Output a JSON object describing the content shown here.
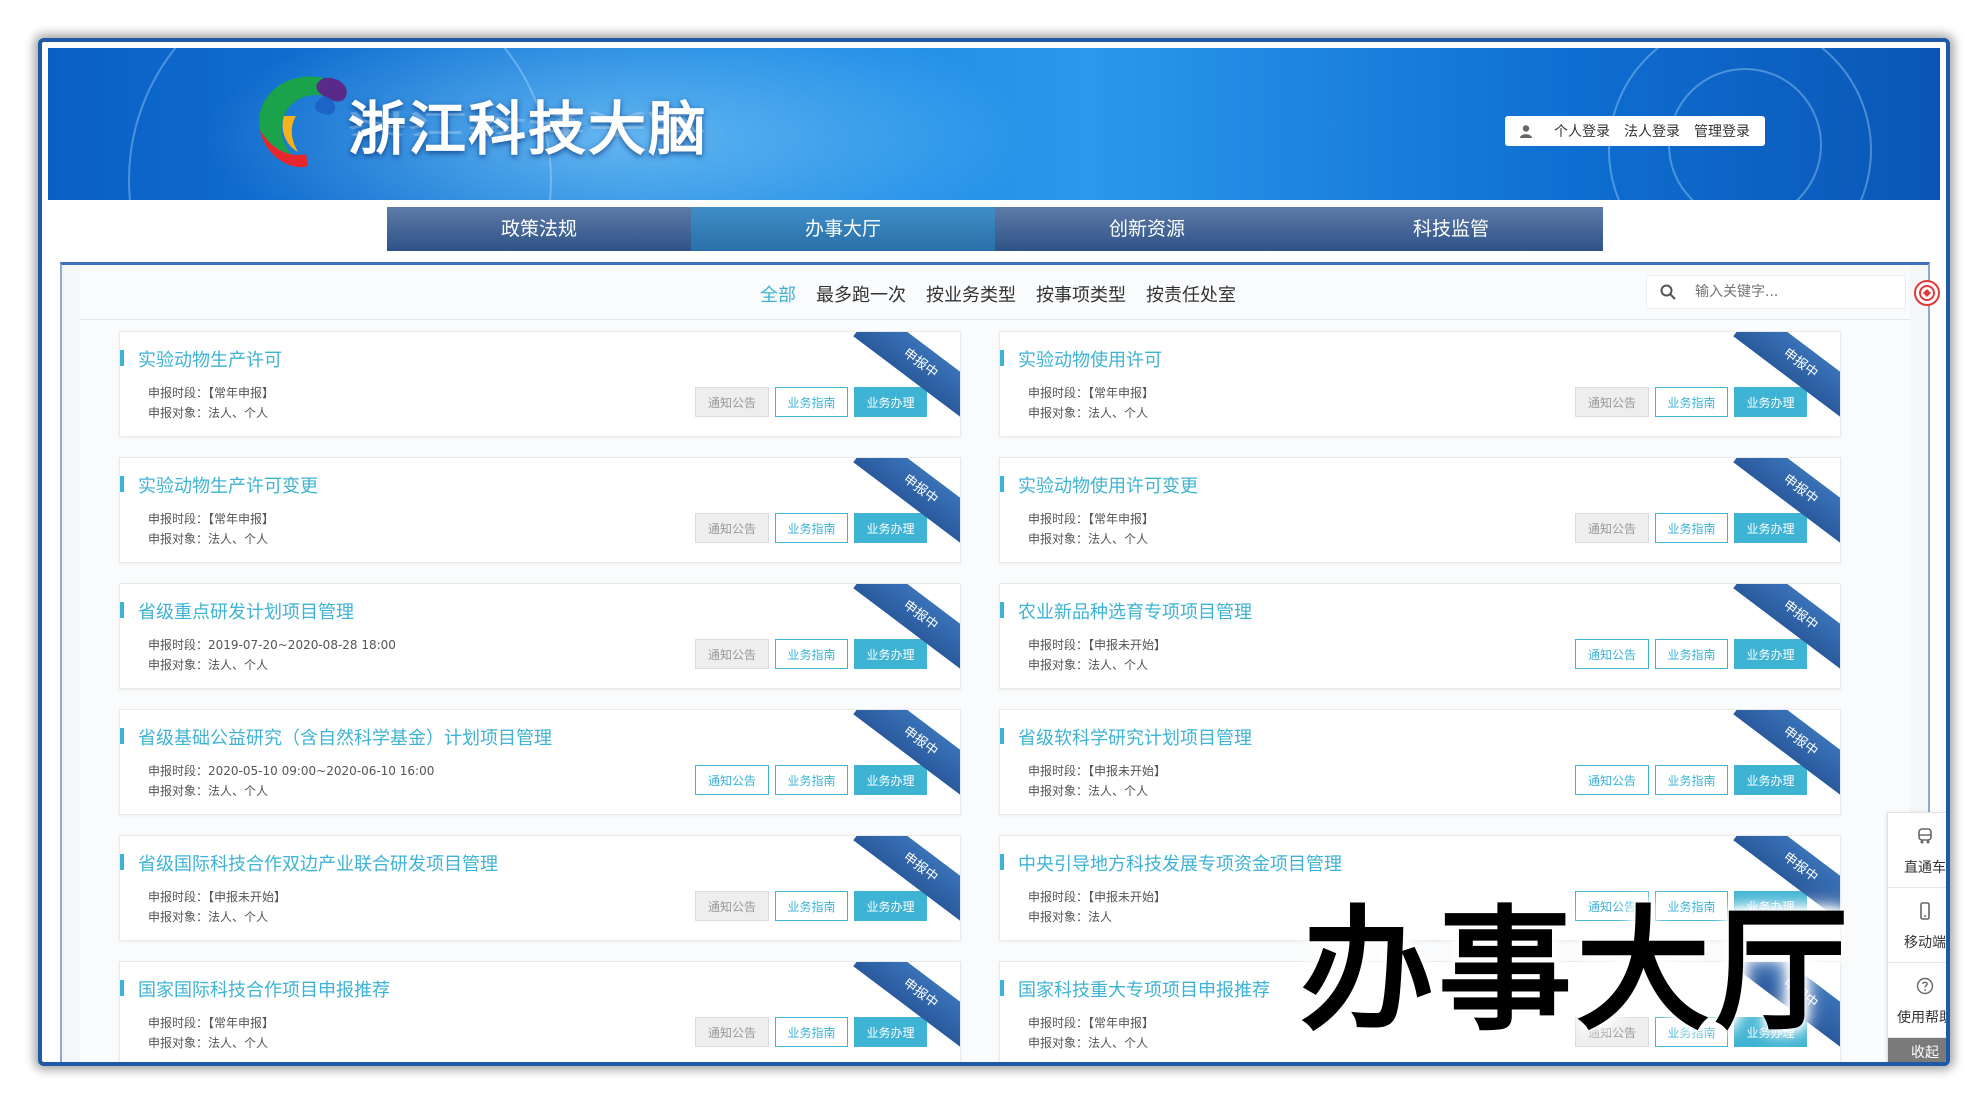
{
  "site": {
    "title": "浙江科技大脑"
  },
  "login": {
    "personal": "个人登录",
    "legal": "法人登录",
    "admin": "管理登录"
  },
  "nav": [
    {
      "label": "政策法规",
      "active": false
    },
    {
      "label": "办事大厅",
      "active": true
    },
    {
      "label": "创新资源",
      "active": false
    },
    {
      "label": "科技监管",
      "active": false
    }
  ],
  "filters": [
    "全部",
    "最多跑一次",
    "按业务类型",
    "按事项类型",
    "按责任处室"
  ],
  "search": {
    "placeholder": "输入关键字..."
  },
  "labels": {
    "period": "申报时段：",
    "target": "申报对象：",
    "status": "申报中",
    "notice": "通知公告",
    "guide": "业务指南",
    "handle": "业务办理"
  },
  "cards": [
    {
      "title": "实验动物生产许可",
      "period": "【常年申报】",
      "target": "法人、个人",
      "notice_enabled": false
    },
    {
      "title": "实验动物使用许可",
      "period": "【常年申报】",
      "target": "法人、个人",
      "notice_enabled": false
    },
    {
      "title": "实验动物生产许可变更",
      "period": "【常年申报】",
      "target": "法人、个人",
      "notice_enabled": false
    },
    {
      "title": "实验动物使用许可变更",
      "period": "【常年申报】",
      "target": "法人、个人",
      "notice_enabled": false
    },
    {
      "title": "省级重点研发计划项目管理",
      "period": "2019-07-20~2020-08-28 18:00",
      "target": "法人、个人",
      "notice_enabled": false
    },
    {
      "title": "农业新品种选育专项项目管理",
      "period": "【申报未开始】",
      "target": "法人、个人",
      "notice_enabled": true
    },
    {
      "title": "省级基础公益研究（含自然科学基金）计划项目管理",
      "period": "2020-05-10 09:00~2020-06-10 16:00",
      "target": "法人、个人",
      "notice_enabled": true
    },
    {
      "title": "省级软科学研究计划项目管理",
      "period": "【申报未开始】",
      "target": "法人、个人",
      "notice_enabled": true
    },
    {
      "title": "省级国际科技合作双边产业联合研发项目管理",
      "period": "【申报未开始】",
      "target": "法人、个人",
      "notice_enabled": false
    },
    {
      "title": "中央引导地方科技发展专项资金项目管理",
      "period": "【申报未开始】",
      "target": "法人",
      "notice_enabled": true
    },
    {
      "title": "国家国际科技合作项目申报推荐",
      "period": "【常年申报】",
      "target": "法人、个人",
      "notice_enabled": false
    },
    {
      "title": "国家科技重大专项项目申报推荐",
      "period": "【常年申报】",
      "target": "法人、个人",
      "notice_enabled": false
    }
  ],
  "side_tools": {
    "express": "直通车",
    "mobile": "移动端",
    "help": "使用帮助",
    "collapse": "收起"
  },
  "caption": "办事大厅",
  "colors": {
    "accent": "#3eb3d3",
    "nav_active": "#3f8ec8",
    "ribbon": "#2a5a9e",
    "banner": "#1a86e2"
  }
}
